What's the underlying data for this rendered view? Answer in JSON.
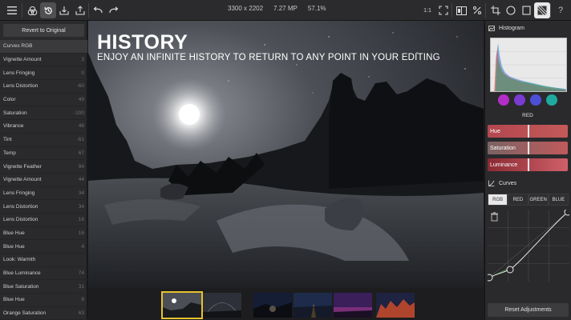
{
  "toolbar": {
    "left_icons": [
      "menu-icon",
      "filters-icon",
      "history-icon",
      "import-icon",
      "share-icon"
    ],
    "undo_icon": "undo-icon",
    "redo_icon": "redo-icon",
    "image_dimensions": "3300 x 2202",
    "megapixels": "7.27 MP",
    "zoom": "57.1%",
    "zoom_1to1": "1:1",
    "right_icons": [
      "fullscreen-icon",
      "compare-icon",
      "percent-icon",
      "crop-icon",
      "circle-icon",
      "square-icon",
      "grid-icon",
      "help-icon"
    ],
    "help_label": "?"
  },
  "left_panel": {
    "revert_label": "Revert to Original",
    "history": [
      {
        "name": "Curves RGB",
        "value": ""
      },
      {
        "name": "Vignette Amount",
        "value": "3"
      },
      {
        "name": "Lens Fringing",
        "value": "0"
      },
      {
        "name": "Lens Distortion",
        "value": "-60"
      },
      {
        "name": "Color",
        "value": "49"
      },
      {
        "name": "Saturation",
        "value": "-100"
      },
      {
        "name": "Vibrance",
        "value": "46"
      },
      {
        "name": "Tint",
        "value": "-61"
      },
      {
        "name": "Temp",
        "value": "67"
      },
      {
        "name": "Vignette Feather",
        "value": "94"
      },
      {
        "name": "Vignette Amount",
        "value": "44"
      },
      {
        "name": "Lens Fringing",
        "value": "34"
      },
      {
        "name": "Lens Distortion",
        "value": "34"
      },
      {
        "name": "Lens Distortion",
        "value": "16"
      },
      {
        "name": "Blue Hue",
        "value": "16"
      },
      {
        "name": "Blue Hue",
        "value": "4"
      },
      {
        "name": "Look: Warmth",
        "value": ""
      },
      {
        "name": "Blue Luminance",
        "value": "74"
      },
      {
        "name": "Blue Saturation",
        "value": "31"
      },
      {
        "name": "Blue Hue",
        "value": "8"
      },
      {
        "name": "Orange Saturation",
        "value": "63"
      }
    ]
  },
  "main": {
    "title": "HISTORY",
    "subtitle": "ENJOY AN INFINITE HISTORY TO RETURN TO ANY POINT IN YOUR EDITING"
  },
  "filmstrip": {
    "thumbnails": 6,
    "selected_index": 0
  },
  "right_panel": {
    "histogram_label": "Histogram",
    "color_dots": [
      "#b22ec8",
      "#7a3bd0",
      "#4d4fd6",
      "#1faaa0"
    ],
    "selected_color": "RED",
    "sliders": [
      {
        "label": "Hue",
        "value": 0.5
      },
      {
        "label": "Saturation",
        "value": 0.5
      },
      {
        "label": "Luminance",
        "value": 0.5
      }
    ],
    "curves_label": "Curves",
    "curve_tabs": [
      "RGB",
      "RED",
      "GREEN",
      "BLUE"
    ],
    "active_curve_tab": "RGB",
    "reset_label": "Reset Adjustments"
  }
}
